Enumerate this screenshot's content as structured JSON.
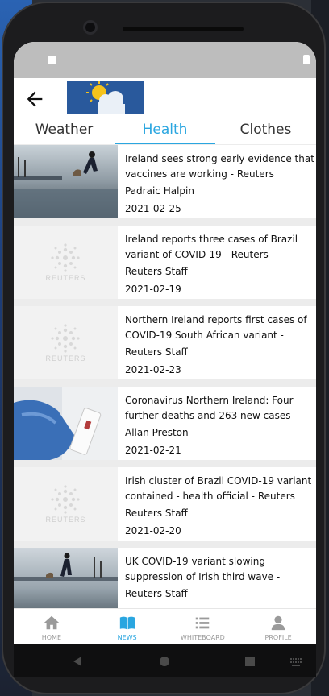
{
  "tabs": [
    {
      "label": "Weather"
    },
    {
      "label": "Health"
    },
    {
      "label": "Clothes"
    }
  ],
  "articles": [
    {
      "title": "Ireland sees strong early evidence that vaccines are working - Reuters",
      "author": "Padraic Halpin",
      "date": "2021-02-25",
      "image": "beach-photo"
    },
    {
      "title": "Ireland reports three cases of Brazil variant of COVID-19 - Reuters",
      "author": "Reuters Staff",
      "date": "2021-02-19",
      "image": "reuters-logo",
      "image_text": "REUTERS"
    },
    {
      "title": "Northern Ireland reports first cases of COVID-19 South African variant - Reuters",
      "author": "Reuters Staff",
      "date": "2021-02-23",
      "image": "reuters-logo",
      "image_text": "REUTERS"
    },
    {
      "title": "Coronavirus Northern Ireland: Four further deaths and 263 new cases confi...",
      "author": "Allan Preston",
      "date": "2021-02-21",
      "image": "test-kit-photo"
    },
    {
      "title": "Irish cluster of Brazil COVID-19 variant contained - health official - Reuters",
      "author": "Reuters Staff",
      "date": "2021-02-20",
      "image": "reuters-logo",
      "image_text": "REUTERS"
    },
    {
      "title": "UK COVID-19 variant slowing suppression of Irish third wave - Reuters",
      "author": "Reuters Staff",
      "date": "",
      "image": "beach-photo-2"
    }
  ],
  "bottom_nav": [
    {
      "label": "HOME",
      "icon": "home-icon"
    },
    {
      "label": "NEWS",
      "icon": "book-icon"
    },
    {
      "label": "WHITEBOARD",
      "icon": "list-icon"
    },
    {
      "label": "PROFILE",
      "icon": "person-icon"
    }
  ],
  "colors": {
    "accent": "#2aa6e0",
    "statusbar": "#bdbdbd",
    "list_bg": "#ececec"
  }
}
